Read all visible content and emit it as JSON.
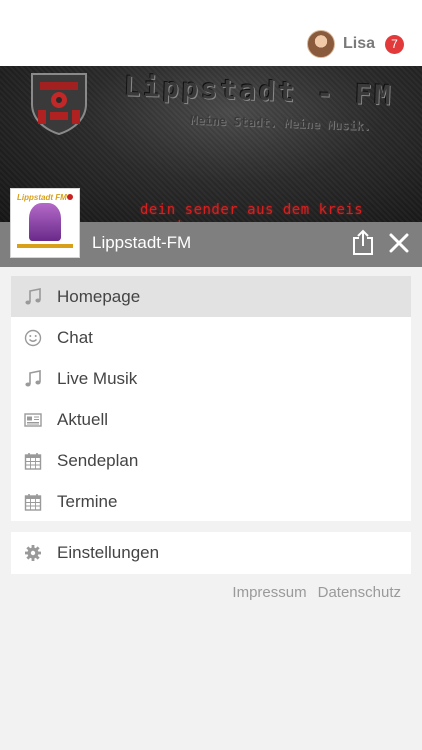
{
  "user": {
    "name": "Lisa",
    "notification_count": "7"
  },
  "banner": {
    "title": "Lippstadt - FM",
    "slogan": "Meine Stadt. Meine Musik.",
    "tagline": "dein sender aus dem kreis soest."
  },
  "station": {
    "name": "Lippstadt-FM",
    "logo_text": "Lippstadt FM"
  },
  "menu": {
    "items": [
      {
        "label": "Homepage",
        "icon": "music-note-icon",
        "active": true
      },
      {
        "label": "Chat",
        "icon": "smiley-icon",
        "active": false
      },
      {
        "label": "Live Musik",
        "icon": "music-note-icon",
        "active": false
      },
      {
        "label": "Aktuell",
        "icon": "newspaper-icon",
        "active": false
      },
      {
        "label": "Sendeplan",
        "icon": "calendar-icon",
        "active": false
      },
      {
        "label": "Termine",
        "icon": "calendar-icon",
        "active": false
      }
    ],
    "settings": {
      "label": "Einstellungen",
      "icon": "gear-icon"
    }
  },
  "footer": {
    "impressum": "Impressum",
    "datenschutz": "Datenschutz"
  },
  "colors": {
    "badge": "#e23a3a",
    "station_bar": "#7f7f7f",
    "tagline": "#d42020",
    "active_item": "#e2e2e2"
  }
}
